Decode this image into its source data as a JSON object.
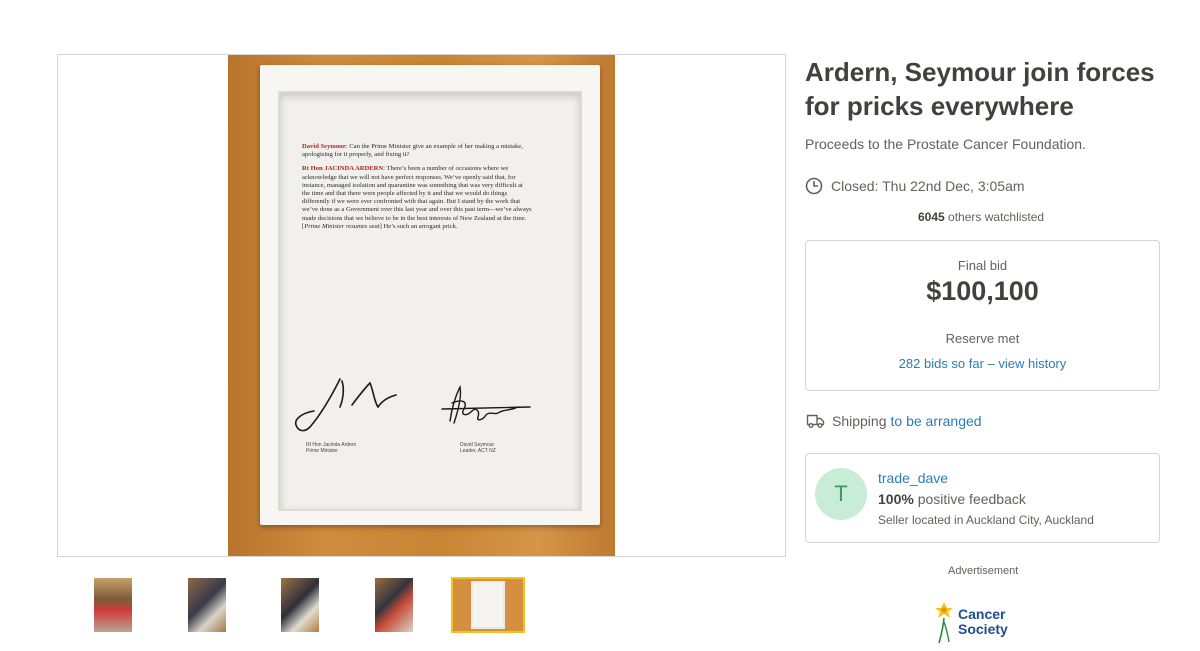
{
  "listing": {
    "title": "Ardern, Seymour join forces for pricks everywhere",
    "subtitle": "Proceeds to the Prostate Cancer Foundation.",
    "closed": "Closed: Thu 22nd Dec, 3:05am",
    "watch_count": "6045",
    "watch_text": "others watchlisted"
  },
  "bid": {
    "label": "Final bid",
    "amount": "$100,100",
    "reserve": "Reserve met",
    "history": "282 bids so far – view history"
  },
  "shipping": {
    "label": "Shipping",
    "link": "to be arranged"
  },
  "seller": {
    "initial": "T",
    "name": "trade_dave",
    "feedback_pct": "100%",
    "feedback_text": "positive feedback",
    "location": "Seller located in Auckland City, Auckland"
  },
  "ad": {
    "label": "Advertisement",
    "logo_line1": "Cancer",
    "logo_line2": "Society"
  },
  "document": {
    "q_speaker": "David Seymour",
    "q_text": ": Can the Prime Minister give an example of her making a mistake, apologising for it properly, and fixing it?",
    "a_speaker": "Rt Hon JACINDA ARDERN",
    "a_text": ": There’s been a number of occasions where we acknowledge that we will not have perfect responses. We’ve openly said that, for instance, managed isolation and quarantine was something that was very difficult at the time and that there were people affected by it and that we would do things differently if we were ever confronted with that again. But I stand by the work that we’ve done as a Government over this last year and over this past term—we’ve always made decisions that we believe to be in the best interests of New Zealand at the time. [",
    "a_italic": "Prime Minister resumes seat",
    "a_end": "] He’s such an arrogant prick.",
    "sig1_name": "Rt Hon Jacinda Ardern",
    "sig1_role": "Prime Minister",
    "sig2_name": "David Seymour",
    "sig2_role": "Leader, ACT NZ"
  },
  "colors": {
    "accent_link": "#2a7db5",
    "text_primary": "#44413d",
    "text_secondary": "#65605d",
    "avatar_bg": "#c9ecd6",
    "thumb_selected_border": "#f0c41b"
  },
  "icons": [
    "clock-icon",
    "truck-icon",
    "daffodil-icon"
  ]
}
